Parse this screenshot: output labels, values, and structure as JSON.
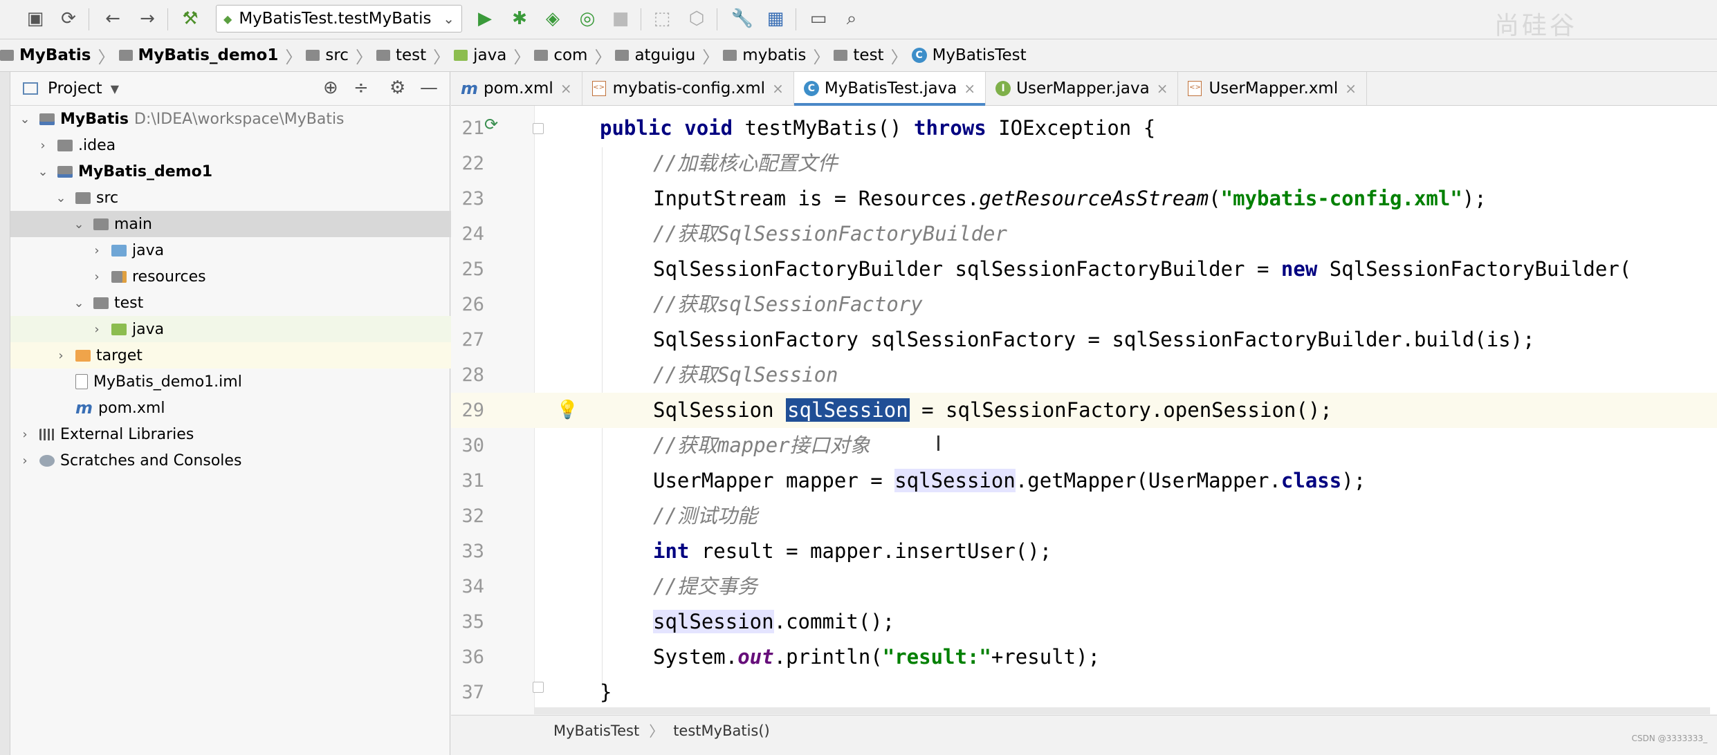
{
  "toolbar": {
    "run_config": "MyBatisTest.testMyBatis",
    "watermark": "尚硅谷"
  },
  "breadcrumb": [
    "MyBatis",
    "MyBatis_demo1",
    "src",
    "test",
    "java",
    "com",
    "atguigu",
    "mybatis",
    "test",
    "MyBatisTest"
  ],
  "project": {
    "title": "Project",
    "tree": [
      {
        "label": "MyBatis",
        "path": "D:\\IDEA\\workspace\\MyBatis"
      },
      {
        "label": ".idea"
      },
      {
        "label": "MyBatis_demo1"
      },
      {
        "label": "src"
      },
      {
        "label": "main"
      },
      {
        "label": "java"
      },
      {
        "label": "resources"
      },
      {
        "label": "test"
      },
      {
        "label": "java"
      },
      {
        "label": "target"
      },
      {
        "label": "MyBatis_demo1.iml"
      },
      {
        "label": "pom.xml"
      },
      {
        "label": "External Libraries"
      },
      {
        "label": "Scratches and Consoles"
      }
    ]
  },
  "tabs": [
    "pom.xml",
    "mybatis-config.xml",
    "MyBatisTest.java",
    "UserMapper.java",
    "UserMapper.xml"
  ],
  "active_tab": "MyBatisTest.java",
  "code": {
    "line_numbers": [
      "21",
      "22",
      "23",
      "24",
      "25",
      "26",
      "27",
      "28",
      "29",
      "30",
      "31",
      "32",
      "33",
      "34",
      "35",
      "36",
      "37"
    ],
    "current_line": "29",
    "l21": {
      "kw1": "public",
      "kw2": "void",
      "name": " testMyBatis() ",
      "kw3": "throws",
      "rest": " IOException {"
    },
    "l22": "//加载核心配置文件",
    "l23": {
      "a": "InputStream is = Resources.",
      "b": "getResourceAsStream",
      "c": "(",
      "s": "\"mybatis-config.xml\"",
      "d": ");"
    },
    "l24": "//获取SqlSessionFactoryBuilder",
    "l25": {
      "a": "SqlSessionFactoryBuilder sqlSessionFactoryBuilder = ",
      "kw": "new",
      "b": " SqlSessionFactoryBuilder("
    },
    "l26": "//获取sqlSessionFactory",
    "l27": "SqlSessionFactory sqlSessionFactory = sqlSessionFactoryBuilder.build(is);",
    "l28": "//获取SqlSession",
    "l29": {
      "a": "SqlSession ",
      "sel": "sqlSession",
      "b": " = sqlSessionFactory.openSession();"
    },
    "l30": "//获取mapper接口对象",
    "l31": {
      "a": "UserMapper mapper = ",
      "u": "sqlSession",
      "b": ".getMapper(UserMapper.",
      "kw": "class",
      "c": ");"
    },
    "l32": "//测试功能",
    "l33": {
      "kw": "int",
      "a": " result = mapper.insertUser();"
    },
    "l34": "//提交事务",
    "l35": {
      "u": "sqlSession",
      "a": ".commit();"
    },
    "l36": {
      "a": "System.",
      "b": "out",
      "c": ".println(",
      "s": "\"result:\"",
      "d": "+result);"
    },
    "l37": "}"
  },
  "editor_breadcrumb": [
    "MyBatisTest",
    "testMyBatis()"
  ],
  "footer_credit": "CSDN @3333333_"
}
